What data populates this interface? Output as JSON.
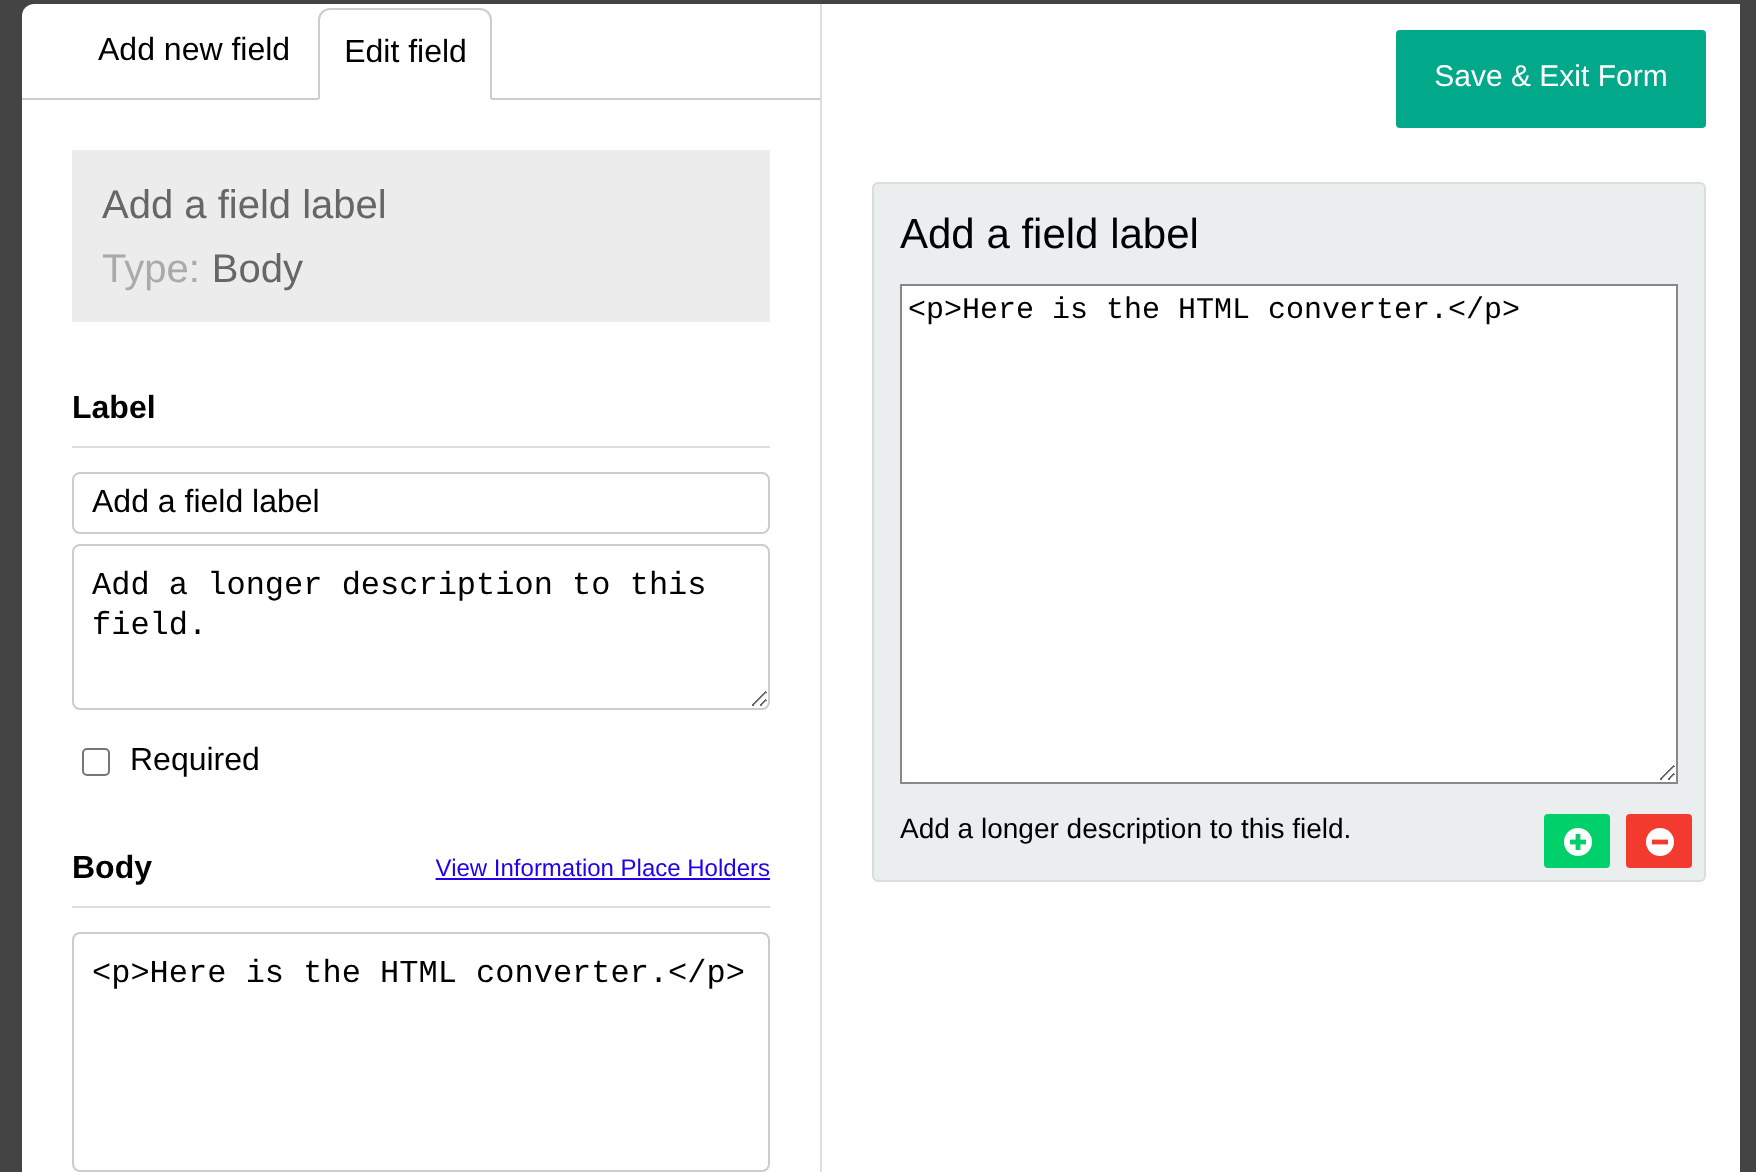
{
  "tabs": [
    {
      "label": "Add new field",
      "selected": false
    },
    {
      "label": "Edit field",
      "selected": true
    }
  ],
  "summary": {
    "title": "Add a field label",
    "type_label": "Type:",
    "type_value": "Body"
  },
  "label_section": {
    "heading": "Label",
    "label_value": "Add a field label",
    "description_value": "Add a longer description to this field.",
    "required": {
      "label": "Required",
      "checked": false
    }
  },
  "body_section": {
    "heading": "Body",
    "link": "View Information Place Holders",
    "value": "<p>Here is the HTML converter.</p>"
  },
  "save_button": "Save & Exit Form",
  "preview": {
    "title": "Add a field label",
    "value": "<p>Here is the HTML converter.</p>",
    "description": "Add a longer description to this field.",
    "actions": [
      {
        "kind": "add"
      },
      {
        "kind": "remove"
      }
    ]
  }
}
